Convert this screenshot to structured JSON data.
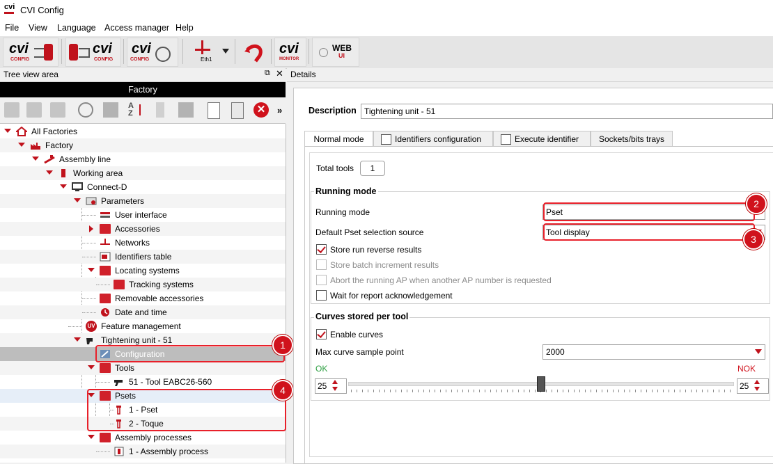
{
  "window": {
    "title": "CVI Config",
    "logo_text": "cvi"
  },
  "menu": [
    "File",
    "View",
    "Language",
    "Access manager",
    "Help"
  ],
  "toolbar": {
    "buttons": [
      {
        "name": "cvi-config-pc-to-tool",
        "label": "cvi",
        "sub": "CONFIG"
      },
      {
        "name": "cvi-config-tool-to-pc",
        "label": "cvi",
        "sub": "CONFIG"
      },
      {
        "name": "cvi-config-search",
        "label": "cvi",
        "sub": "CONFIG"
      },
      {
        "name": "ethernet",
        "label": "Eth1"
      },
      {
        "name": "undo",
        "label": ""
      },
      {
        "name": "cvi-monitor",
        "label": "cvi",
        "sub": "MONITOR"
      },
      {
        "name": "web-ui",
        "label": "WEB",
        "sub": "UI"
      }
    ]
  },
  "tree_panel": {
    "header": "Tree view area",
    "root_bar": "Factory"
  },
  "tree": [
    {
      "label": "All Factories"
    },
    {
      "label": "Factory"
    },
    {
      "label": "Assembly line"
    },
    {
      "label": "Working area"
    },
    {
      "label": "Connect-D"
    },
    {
      "label": "Parameters"
    },
    {
      "label": "User interface"
    },
    {
      "label": "Accessories"
    },
    {
      "label": "Networks"
    },
    {
      "label": "Identifiers table"
    },
    {
      "label": "Locating systems"
    },
    {
      "label": "Tracking systems"
    },
    {
      "label": "Removable accessories"
    },
    {
      "label": "Date and time"
    },
    {
      "label": "Feature management"
    },
    {
      "label": "Tightening unit - 51"
    },
    {
      "label": "Configuration"
    },
    {
      "label": "Tools"
    },
    {
      "label": "51 - Tool EABC26-560"
    },
    {
      "label": "Psets"
    },
    {
      "label": "1 - Pset"
    },
    {
      "label": "2 - Toque"
    },
    {
      "label": "Assembly processes"
    },
    {
      "label": "1 - Assembly process"
    }
  ],
  "details": {
    "header": "Details",
    "description_label": "Description",
    "description_value": "Tightening unit - 51",
    "tabs": [
      "Normal mode",
      "Identifiers configuration",
      "Execute identifier",
      "Sockets/bits trays"
    ],
    "total_tools_label": "Total tools",
    "total_tools_value": "1",
    "running_mode": {
      "title": "Running mode",
      "mode_label": "Running mode",
      "mode_value": "Pset",
      "source_label": "Default Pset selection source",
      "source_value": "Tool display",
      "checks": [
        {
          "label": "Store run reverse results",
          "checked": true,
          "enabled": true
        },
        {
          "label": "Store batch increment results",
          "checked": false,
          "enabled": false
        },
        {
          "label": "Abort the running AP when another AP number is requested",
          "checked": false,
          "enabled": false
        },
        {
          "label": "Wait for report acknowledgement",
          "checked": false,
          "enabled": true
        }
      ]
    },
    "curves": {
      "title": "Curves stored per tool",
      "enable_label": "Enable curves",
      "enable_checked": true,
      "max_label": "Max curve sample point",
      "max_value": "2000",
      "ok_label": "OK",
      "nok_label": "NOK",
      "ok_value": "25",
      "nok_value": "25",
      "slider_fraction": 0.5
    }
  },
  "annotations": [
    "1",
    "2",
    "3",
    "4"
  ],
  "colors": {
    "accent": "#c0121c",
    "annotation": "#e8202a",
    "ok": "#2ea043",
    "nok": "#d0121c"
  }
}
